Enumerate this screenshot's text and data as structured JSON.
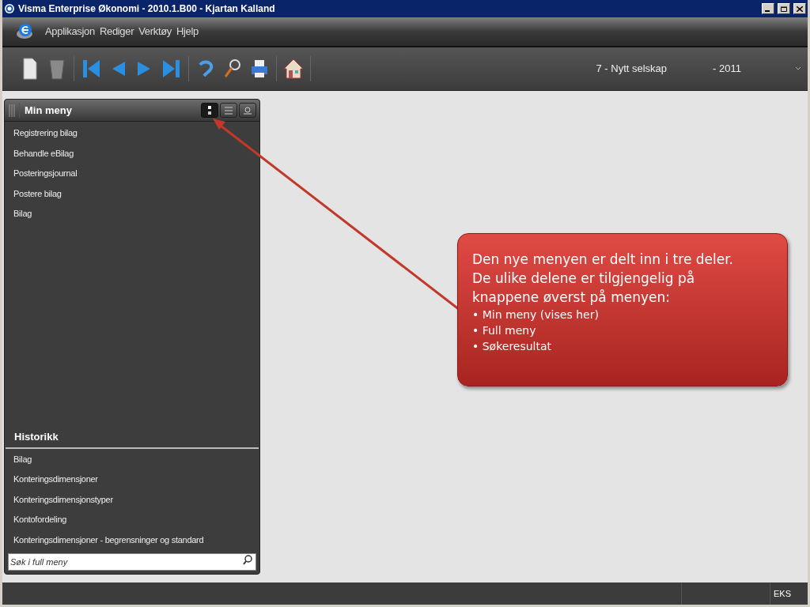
{
  "window": {
    "title": "Visma Enterprise Økonomi - 2010.1.B00 - Kjartan Kalland"
  },
  "menu_bar": [
    "Applikasjon",
    "Rediger",
    "Verktøy",
    "Hjelp"
  ],
  "toolbar": {
    "company": "7 - Nytt selskap",
    "year": "- 2011"
  },
  "panel": {
    "title": "Min meny",
    "view_buttons": [
      {
        "kind": "dots",
        "selected": true
      },
      {
        "kind": "list",
        "selected": false
      },
      {
        "kind": "search",
        "selected": false
      }
    ],
    "items": [
      "Registrering bilag",
      "Behandle eBilag",
      "Posteringsjournal",
      "Postere bilag",
      "Bilag"
    ],
    "history_title": "Historikk",
    "history": [
      "Bilag",
      "Konteringsdimensjoner",
      "Konteringsdimensjonstyper",
      "Kontofordeling",
      "Konteringsdimensjoner - begrensninger og standard"
    ],
    "search": {
      "placeholder": "Søk i full meny"
    }
  },
  "callout": {
    "lines": [
      "Den nye menyen er delt inn i tre deler.",
      "De ulike delene er tilgjengelig på",
      "knappene øverst på menyen:"
    ],
    "bullets": [
      "• Min meny (vises her)",
      "• Full meny",
      "• Søkeresultat"
    ]
  },
  "status_bar": {
    "mode": "EKS"
  }
}
